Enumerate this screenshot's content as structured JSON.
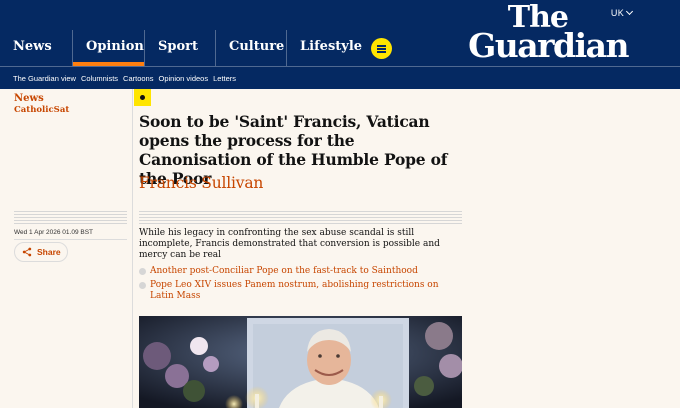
{
  "header": {
    "edition": "UK",
    "logo_line1": "The",
    "logo_line2": "Guardian",
    "pillars": [
      "News",
      "Opinion",
      "Sport",
      "Culture",
      "Lifestyle"
    ],
    "active_pillar": "Opinion",
    "accent_color": "#ff7f0f",
    "brand_color": "#052962"
  },
  "subnav": [
    "The Guardian view",
    "Columnists",
    "Cartoons",
    "Opinion videos",
    "Letters"
  ],
  "sidebar": {
    "section": "News",
    "series": "CatholicSat",
    "dateline": "Wed 1 Apr 2026 01.09 BST",
    "share_label": "Share"
  },
  "article": {
    "headline": "Soon to be 'Saint' Francis, Vatican opens the process for the Canonisation of the Humble Pope of the Poor",
    "byline": "Francis Sullivan",
    "standfirst": "While his legacy in confronting the sex abuse scandal is still incomplete, Francis demonstrated that conversion is possible and mercy can be real",
    "related": [
      "Another post-Conciliar Pope on the fast-track to Sainthood",
      "Pope Leo XIV issues Panem nostrum, abolishing restrictions on Latin Mass"
    ],
    "highlight_color": "#c74600"
  }
}
